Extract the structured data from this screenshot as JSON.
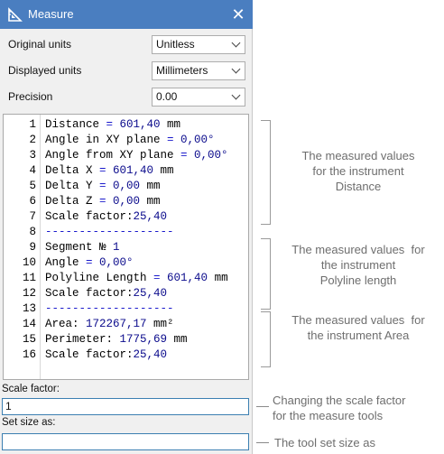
{
  "window": {
    "title": "Measure",
    "close_glyph": "✕"
  },
  "settings": {
    "original_units": {
      "label": "Original units",
      "value": "Unitless"
    },
    "displayed_units": {
      "label": "Displayed units",
      "value": "Millimeters"
    },
    "precision": {
      "label": "Precision",
      "value": "0.00"
    }
  },
  "results": {
    "lines": [
      {
        "n": "1",
        "parts": [
          [
            "t",
            "Distance "
          ],
          [
            "o",
            "= "
          ],
          [
            "v",
            "601,40"
          ],
          [
            "t",
            " mm"
          ]
        ]
      },
      {
        "n": "2",
        "parts": [
          [
            "t",
            "Angle in XY plane "
          ],
          [
            "o",
            "= "
          ],
          [
            "v",
            "0,00°"
          ]
        ]
      },
      {
        "n": "3",
        "parts": [
          [
            "t",
            "Angle from XY plane "
          ],
          [
            "o",
            "= "
          ],
          [
            "v",
            "0,00°"
          ]
        ]
      },
      {
        "n": "4",
        "parts": [
          [
            "t",
            "Delta X "
          ],
          [
            "o",
            "= "
          ],
          [
            "v",
            "601,40"
          ],
          [
            "t",
            " mm"
          ]
        ]
      },
      {
        "n": "5",
        "parts": [
          [
            "t",
            "Delta Y "
          ],
          [
            "o",
            "= "
          ],
          [
            "v",
            "0,00"
          ],
          [
            "t",
            " mm"
          ]
        ]
      },
      {
        "n": "6",
        "parts": [
          [
            "t",
            "Delta Z "
          ],
          [
            "o",
            "= "
          ],
          [
            "v",
            "0,00"
          ],
          [
            "t",
            " mm"
          ]
        ]
      },
      {
        "n": "7",
        "parts": [
          [
            "t",
            "Scale factor:"
          ],
          [
            "v",
            "25,40"
          ]
        ]
      },
      {
        "n": "8",
        "parts": [
          [
            "d",
            "-------------------"
          ]
        ]
      },
      {
        "n": "9",
        "parts": [
          [
            "t",
            "Segment № "
          ],
          [
            "v",
            "1"
          ]
        ]
      },
      {
        "n": "10",
        "parts": [
          [
            "t",
            "Angle "
          ],
          [
            "o",
            "= "
          ],
          [
            "v",
            "0,00°"
          ]
        ]
      },
      {
        "n": "11",
        "parts": [
          [
            "t",
            "Polyline Length "
          ],
          [
            "o",
            "= "
          ],
          [
            "v",
            "601,40"
          ],
          [
            "t",
            " mm"
          ]
        ]
      },
      {
        "n": "12",
        "parts": [
          [
            "t",
            "Scale factor:"
          ],
          [
            "v",
            "25,40"
          ]
        ]
      },
      {
        "n": "13",
        "parts": [
          [
            "d",
            "-------------------"
          ]
        ]
      },
      {
        "n": "14",
        "parts": [
          [
            "t",
            "Area: "
          ],
          [
            "v",
            "172267,17"
          ],
          [
            "t",
            " mm²"
          ]
        ]
      },
      {
        "n": "15",
        "parts": [
          [
            "t",
            "Perimeter: "
          ],
          [
            "v",
            "1775,69"
          ],
          [
            "t",
            " mm"
          ]
        ]
      },
      {
        "n": "16",
        "parts": [
          [
            "t",
            "Scale factor:"
          ],
          [
            "v",
            "25,40"
          ]
        ]
      }
    ]
  },
  "scale_factor": {
    "label": "Scale factor:",
    "value": "1"
  },
  "set_size": {
    "label": "Set size as:",
    "value": ""
  },
  "annotations": {
    "distance": "The measured values\nfor the instrument\nDistance",
    "polyline": "The measured values  for\nthe instrument\nPolyline length",
    "area": "The measured values  for\nthe instrument Area",
    "scale": "Changing the scale factor\nfor the measure tools",
    "setsize": "The tool set size as"
  },
  "colors": {
    "titlebar": "#4a7ec0",
    "operator": "#1a1acc",
    "value": "#0a0a8c",
    "annotation": "#6e6e6e"
  }
}
